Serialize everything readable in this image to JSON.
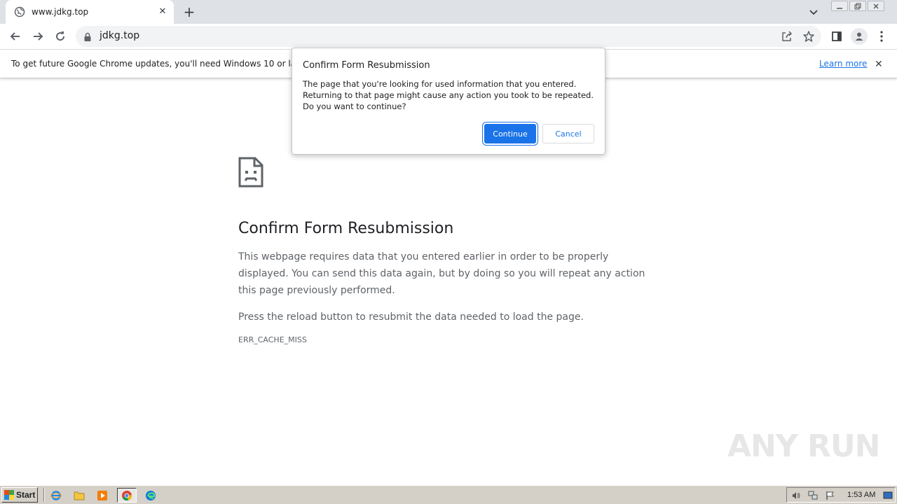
{
  "tab": {
    "title": "www.jdkg.top"
  },
  "omnibox": {
    "url": "jdkg.top"
  },
  "infobar": {
    "message": "To get future Google Chrome updates, you'll need Windows 10 or later.",
    "learn_more": "Learn more"
  },
  "error_page": {
    "heading": "Confirm Form Resubmission",
    "paragraph1": "This webpage requires data that you entered earlier in order to be properly displayed. You can send this data again, but by doing so you will repeat any action this page previously performed.",
    "paragraph2": "Press the reload button to resubmit the data needed to load the page.",
    "error_code": "ERR_CACHE_MISS"
  },
  "dialog": {
    "title": "Confirm Form Resubmission",
    "body_line1": "The page that you're looking for used information that you entered.",
    "body_line2": "Returning to that page might cause any action you took to be repeated.",
    "body_line3": "Do you want to continue?",
    "continue_label": "Continue",
    "cancel_label": "Cancel"
  },
  "watermark": {
    "text": "ANY RUN"
  },
  "taskbar": {
    "start_label": "Start",
    "clock": "1:53 AM"
  },
  "colors": {
    "accent": "#1a73e8",
    "tabstrip": "#dee1e6",
    "taskbar": "#d4d0c8"
  }
}
